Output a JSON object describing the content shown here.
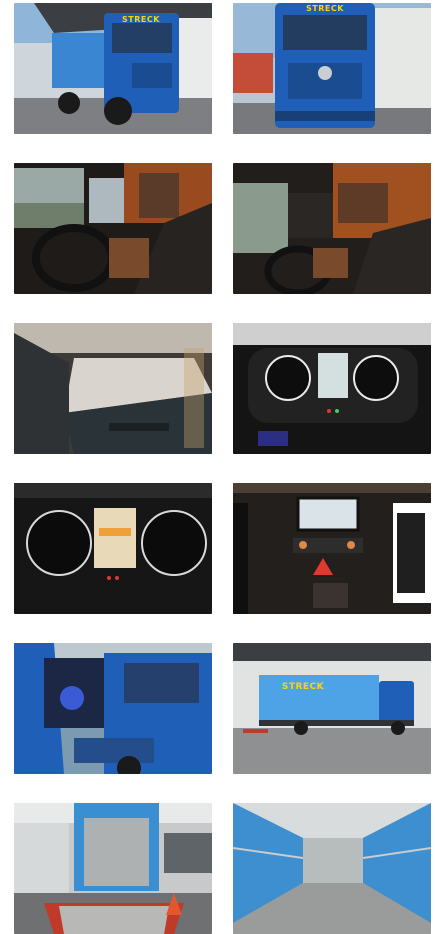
{
  "gallery": {
    "photos": [
      {
        "id": "truck-front-left",
        "badge": "STRECK"
      },
      {
        "id": "truck-front",
        "badge": "STRECK"
      },
      {
        "id": "cabin-driver-seat",
        "badge": ""
      },
      {
        "id": "cabin-passenger-side",
        "badge": ""
      },
      {
        "id": "sleeper-bunk",
        "badge": ""
      },
      {
        "id": "instrument-cluster",
        "badge": ""
      },
      {
        "id": "instrument-cluster-closeup",
        "badge": ""
      },
      {
        "id": "center-console-display",
        "badge": ""
      },
      {
        "id": "cab-door-open",
        "badge": ""
      },
      {
        "id": "truck-side-view",
        "badge": "STRECK"
      },
      {
        "id": "cargo-rear-liftgate",
        "badge": ""
      },
      {
        "id": "cargo-interior",
        "badge": ""
      }
    ]
  },
  "colors": {
    "truck_blue": "#1f5fb8",
    "tarp_blue": "#4ea3e6",
    "accent_yellow": "#ffd400",
    "interior_dark": "#2a2a2a",
    "leather_brown": "#7a4a2c"
  }
}
